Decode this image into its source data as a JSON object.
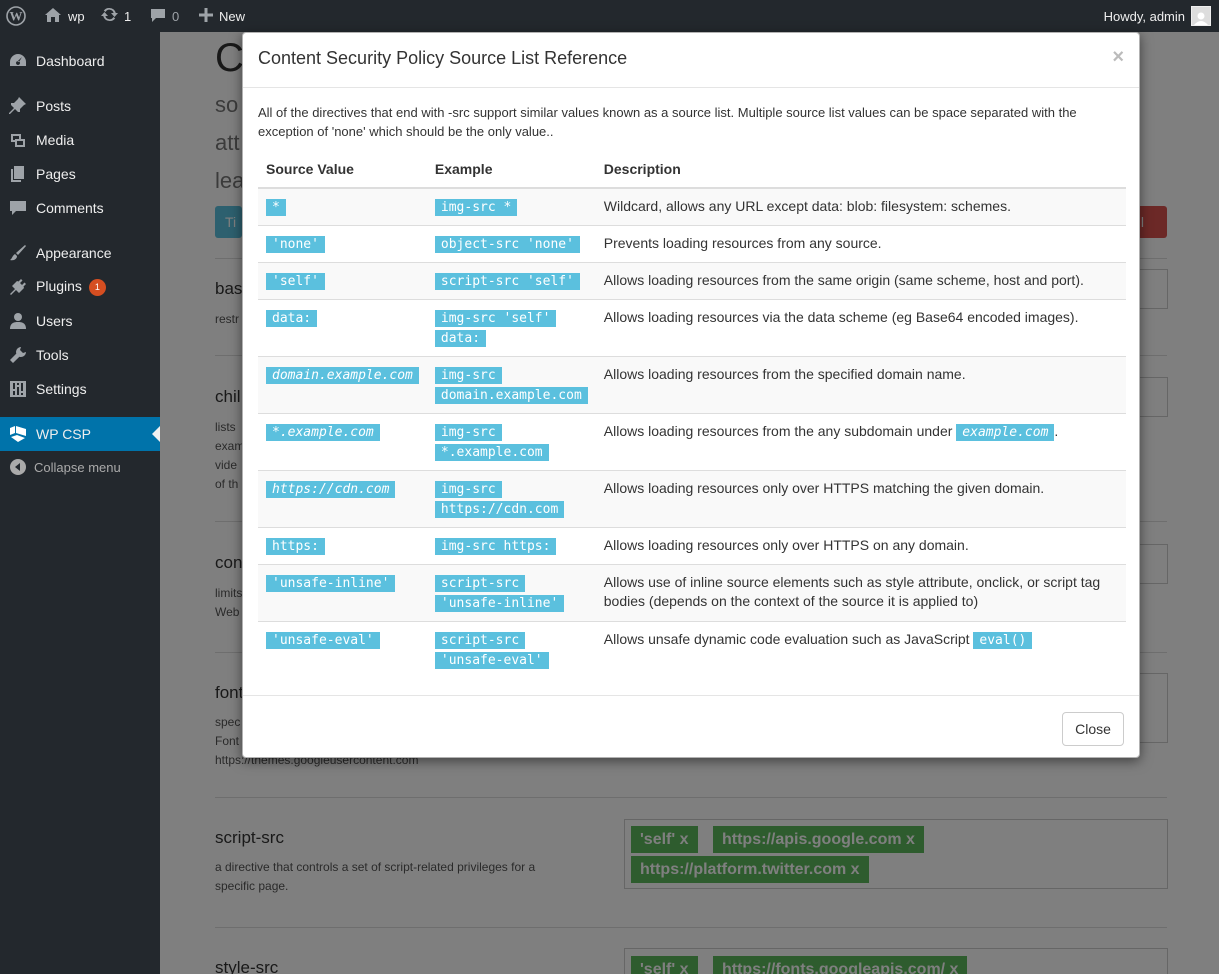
{
  "adminbar": {
    "site_name": "wp",
    "updates_count": "1",
    "comments_count": "0",
    "new_label": "New",
    "account_label": "Howdy, admin"
  },
  "menu": {
    "items": [
      {
        "label": "Dashboard",
        "icon": "dashboard-icon"
      },
      {
        "label": "Posts",
        "icon": "pin-icon"
      },
      {
        "label": "Media",
        "icon": "media-icon"
      },
      {
        "label": "Pages",
        "icon": "pages-icon"
      },
      {
        "label": "Comments",
        "icon": "comments-icon"
      },
      {
        "label": "Appearance",
        "icon": "brush-icon"
      },
      {
        "label": "Plugins",
        "icon": "plugin-icon",
        "badge": "1"
      },
      {
        "label": "Users",
        "icon": "users-icon"
      },
      {
        "label": "Tools",
        "icon": "wrench-icon"
      },
      {
        "label": "Settings",
        "icon": "settings-icon"
      },
      {
        "label": "WP CSP",
        "icon": "wp-csp-icon"
      }
    ],
    "collapse_label": "Collapse menu"
  },
  "page": {
    "title_fragment": "C",
    "bg_lines": [
      "so",
      "att",
      "lea"
    ],
    "bg_button_left": "Ti",
    "bg_button_right": "all",
    "directives": [
      {
        "title": "bas",
        "desc": "restr"
      },
      {
        "title": "chil",
        "desc": "lists\nexam\nvide\nof th"
      },
      {
        "title": "con",
        "desc": "limits\nWeb"
      },
      {
        "title": "font",
        "desc": "spec\nFont\nhttps://themes.googleusercontent.com"
      },
      {
        "title": "script-src",
        "desc": "a directive that controls a set of script-related privileges for a specific page.",
        "chips": [
          "'self'  x",
          "https://apis.google.com  x",
          "https://platform.twitter.com  x"
        ]
      },
      {
        "title": "style-src",
        "chips": [
          "'self'  x",
          "https://fonts.googleapis.com/  x"
        ]
      }
    ]
  },
  "modal": {
    "title": "Content Security Policy Source List Reference",
    "close_x": "×",
    "intro": "All of the directives that end with -src support similar values known as a source list. Multiple source list values can be space separated with the exception of 'none' which should be the only value..",
    "headers": [
      "Source Value",
      "Example",
      "Description"
    ],
    "rows": [
      {
        "value": "*",
        "example": "img-src *",
        "description": "Wildcard, allows any URL except data: blob: filesystem: schemes."
      },
      {
        "value": "'none'",
        "example": "object-src 'none'",
        "description": "Prevents loading resources from any source."
      },
      {
        "value": "'self'",
        "example": "script-src 'self'",
        "description": "Allows loading resources from the same origin (same scheme, host and port)."
      },
      {
        "value": "data:",
        "example": "img-src 'self' data:",
        "description": "Allows loading resources via the data scheme (eg Base64 encoded images)."
      },
      {
        "value": "domain.example.com",
        "value_italic": true,
        "example": "img-src domain.example.com",
        "description": "Allows loading resources from the specified domain name."
      },
      {
        "value": "*.example.com",
        "value_italic": true,
        "example": "img-src *.example.com",
        "description": "Allows loading resources from the any subdomain under",
        "description_code": "example.com",
        "description_code_italic": true,
        "description_after": "."
      },
      {
        "value": "https://cdn.com",
        "value_italic": true,
        "example": "img-src https://cdn.com",
        "description": "Allows loading resources only over HTTPS matching the given domain."
      },
      {
        "value": "https:",
        "example": "img-src https:",
        "description": "Allows loading resources only over HTTPS on any domain."
      },
      {
        "value": "'unsafe-inline'",
        "example": "script-src 'unsafe-inline'",
        "description": "Allows use of inline source elements such as style attribute, onclick, or script tag bodies (depends on the context of the source it is applied to)"
      },
      {
        "value": "'unsafe-eval'",
        "example": "script-src 'unsafe-eval'",
        "description": "Allows unsafe dynamic code evaluation such as JavaScript",
        "description_code": "eval()",
        "description_after": ""
      }
    ],
    "close_button": "Close"
  }
}
